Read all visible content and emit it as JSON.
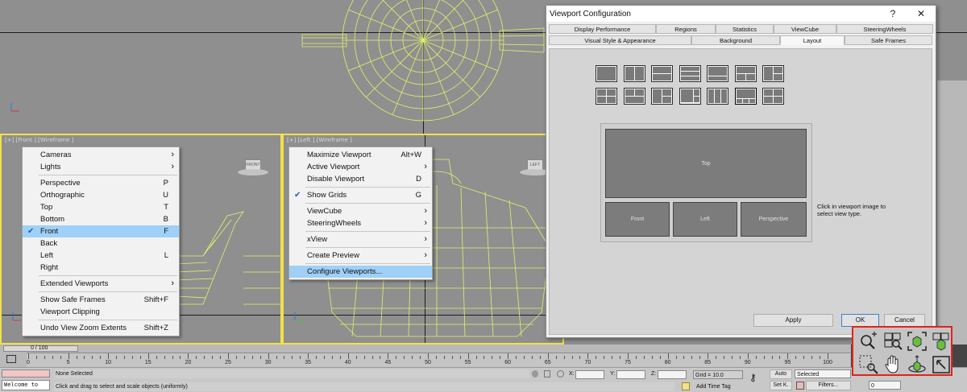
{
  "viewports": {
    "front_label": "[+] [Front ] [Wireframe ]",
    "left_label": "[+] [Left ] [Wireframe ]",
    "viewcube_front": "FRONT",
    "viewcube_left": "LEFT"
  },
  "front_menu": {
    "items": [
      {
        "label": "Cameras",
        "submenu": true
      },
      {
        "label": "Lights",
        "submenu": true
      },
      {
        "sep": true
      },
      {
        "label": "Perspective",
        "shortcut": "P"
      },
      {
        "label": "Orthographic",
        "shortcut": "U"
      },
      {
        "label": "Top",
        "shortcut": "T"
      },
      {
        "label": "Bottom",
        "shortcut": "B"
      },
      {
        "label": "Front",
        "shortcut": "F",
        "checked": true,
        "highlighted": true
      },
      {
        "label": "Back"
      },
      {
        "label": "Left",
        "shortcut": "L"
      },
      {
        "label": "Right"
      },
      {
        "sep": true
      },
      {
        "label": "Extended Viewports",
        "submenu": true
      },
      {
        "sep": true
      },
      {
        "label": "Show Safe Frames",
        "shortcut": "Shift+F"
      },
      {
        "label": "Viewport Clipping"
      },
      {
        "sep": true
      },
      {
        "label": "Undo View Zoom Extents",
        "shortcut": "Shift+Z"
      }
    ]
  },
  "left_menu": {
    "items": [
      {
        "label": "Maximize Viewport",
        "shortcut": "Alt+W"
      },
      {
        "label": "Active Viewport",
        "submenu": true
      },
      {
        "label": "Disable Viewport",
        "shortcut": "D"
      },
      {
        "sep": true
      },
      {
        "label": "Show Grids",
        "shortcut": "G",
        "checked": true
      },
      {
        "sep": true
      },
      {
        "label": "ViewCube",
        "submenu": true
      },
      {
        "label": "SteeringWheels",
        "submenu": true
      },
      {
        "sep": true
      },
      {
        "label": "xView",
        "submenu": true
      },
      {
        "sep": true
      },
      {
        "label": "Create Preview",
        "submenu": true
      },
      {
        "sep": true
      },
      {
        "label": "Configure Viewports...",
        "highlighted": true
      }
    ]
  },
  "dialog": {
    "title": "Viewport Configuration",
    "help": "?",
    "close": "✕",
    "tabs_row1": [
      "Display Performance",
      "Regions",
      "Statistics",
      "ViewCube",
      "SteeringWheels"
    ],
    "tabs_row2": [
      "Visual Style & Appearance",
      "Background",
      "Layout",
      "Safe Frames"
    ],
    "active_tab": "Layout",
    "preview": {
      "top": "Top",
      "front": "Front",
      "left": "Left",
      "perspective": "Perspective"
    },
    "hint": "Click in viewport image to select view type.",
    "apply": "Apply",
    "ok": "OK",
    "cancel": "Cancel"
  },
  "timeline": {
    "slider": "0 / 100",
    "labels": [
      "0",
      "5",
      "10",
      "15",
      "20",
      "25",
      "30",
      "35",
      "40",
      "45",
      "50",
      "55",
      "60",
      "65",
      "70",
      "75",
      "80",
      "85",
      "90",
      "95",
      "100"
    ]
  },
  "status": {
    "listener": "Welcome to",
    "selection": "None Selected",
    "prompt": "Click and drag to select and scale objects (uniformly)",
    "x_label": "X:",
    "y_label": "Y:",
    "z_label": "Z:",
    "grid": "Grid = 10.0",
    "add_time_tag": "Add Time Tag",
    "auto": "Auto",
    "set_key": "Set K.",
    "selected": "Selected",
    "filters": "Filters...",
    "frame": "0"
  },
  "nav_controls": [
    "zoom-icon",
    "zoom-all-icon",
    "zoom-extents-icon",
    "zoom-extents-all-icon",
    "zoom-region-icon",
    "pan-icon",
    "orbit-icon",
    "maximize-toggle-icon"
  ]
}
